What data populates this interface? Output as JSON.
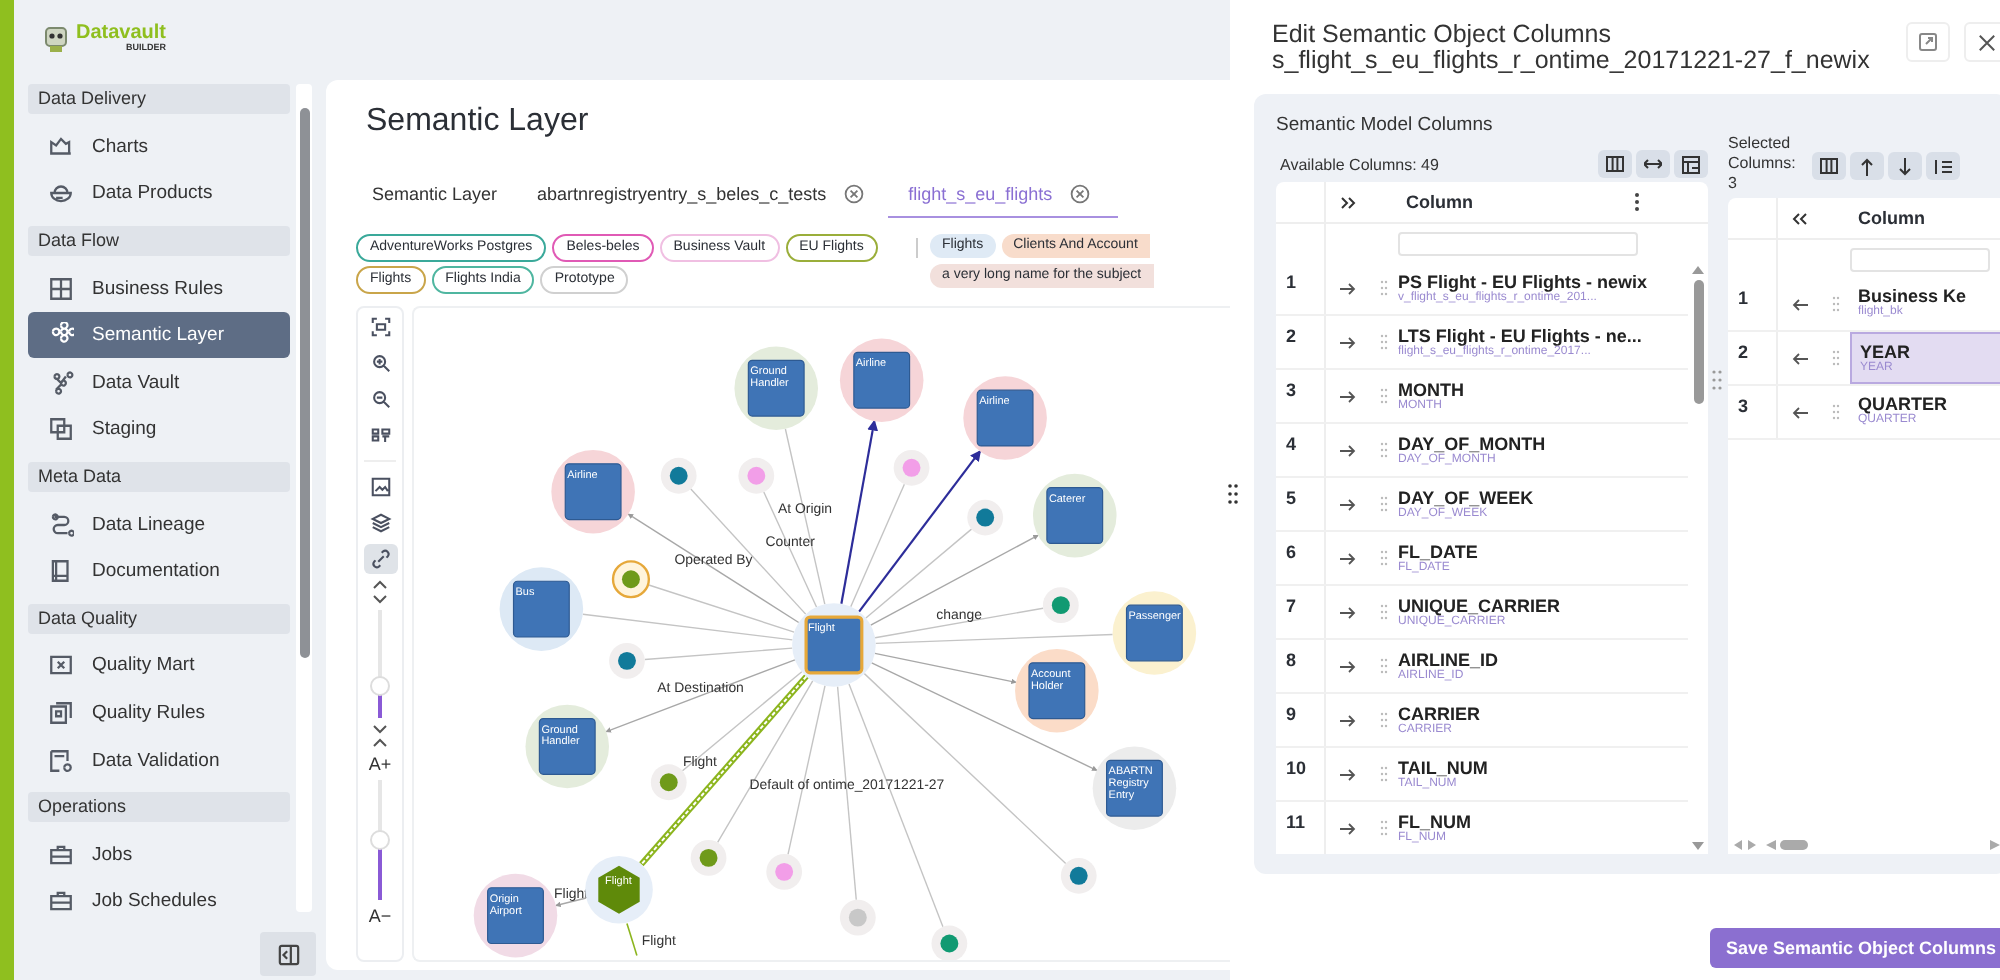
{
  "logo": {
    "name": "Datavault",
    "subtitle": "BUILDER"
  },
  "sidebar": {
    "sections": [
      {
        "title": "Data Delivery",
        "items": [
          {
            "label": "Charts",
            "selected": false
          },
          {
            "label": "Data Products",
            "selected": false
          }
        ]
      },
      {
        "title": "Data Flow",
        "items": [
          {
            "label": "Business Rules",
            "selected": false
          },
          {
            "label": "Semantic Layer",
            "selected": true
          },
          {
            "label": "Data Vault",
            "selected": false
          },
          {
            "label": "Staging",
            "selected": false
          }
        ]
      },
      {
        "title": "Meta Data",
        "items": [
          {
            "label": "Data Lineage",
            "selected": false
          },
          {
            "label": "Documentation",
            "selected": false
          }
        ]
      },
      {
        "title": "Data Quality",
        "items": [
          {
            "label": "Quality Mart",
            "selected": false
          },
          {
            "label": "Quality Rules",
            "selected": false
          },
          {
            "label": "Data Validation",
            "selected": false
          }
        ]
      },
      {
        "title": "Operations",
        "items": [
          {
            "label": "Jobs",
            "selected": false
          },
          {
            "label": "Job Schedules",
            "selected": false
          }
        ]
      }
    ]
  },
  "page": {
    "title": "Semantic Layer",
    "tabs": [
      {
        "label": "Semantic Layer",
        "selected": false,
        "closable": false
      },
      {
        "label": "abartnregistryentry_s_beles_c_tests",
        "selected": false,
        "closable": true
      },
      {
        "label": "flight_s_eu_flights",
        "selected": true,
        "closable": true
      }
    ],
    "source_tags": [
      {
        "label": "AdventureWorks Postgres",
        "color": "#3aa99a"
      },
      {
        "label": "Beles-beles",
        "color": "#e05ab5"
      },
      {
        "label": "Business Vault",
        "color": "#f0bfe2"
      },
      {
        "label": "EU Flights",
        "color": "#9aae3a"
      },
      {
        "label": "Flights",
        "color": "#c9a54a"
      },
      {
        "label": "Flights India",
        "color": "#4fb6a0"
      },
      {
        "label": "Prototype",
        "color": "#d0d0d0"
      }
    ],
    "subject_tags": [
      {
        "label": "Flights",
        "color": "#dfeaf5"
      },
      {
        "label": "Clients And Account",
        "color": "#f8dccb"
      },
      {
        "label": "a very long name for the subject",
        "color": "#f2e0dc"
      }
    ]
  },
  "graph_toolbar": {
    "tools": [
      {
        "selected": false
      },
      {
        "selected": false
      },
      {
        "selected": false
      },
      {
        "selected": false
      },
      {
        "selected": false
      },
      {
        "selected": false
      },
      {
        "selected": true
      }
    ],
    "zoom": {
      "level": 0.3
    },
    "font_size": {
      "increase": "A+",
      "decrease": "A−",
      "level": 0.5
    }
  },
  "graph": {
    "nodes": [
      {
        "kind": "entity",
        "label": "Airline",
        "color": "#f6d5d8",
        "selected": false,
        "edge": {
          "kind": "directed"
        }
      },
      {
        "kind": "entity",
        "label": "Ground Handler",
        "color": "#e4ecdc",
        "selected": false,
        "edge": {
          "kind": "plain",
          "label": "At Origin"
        }
      },
      {
        "kind": "entity",
        "label": "Airline",
        "color": "#f6d5d8",
        "selected": false,
        "edge": {
          "kind": "directed"
        }
      },
      {
        "kind": "dot",
        "color": "#f29ee8",
        "selected": false,
        "edge": {
          "kind": "plain"
        }
      },
      {
        "kind": "dot",
        "color": "#117a9a",
        "selected": false,
        "edge": {
          "kind": "plain"
        }
      },
      {
        "kind": "dot",
        "color": "#f29ee8",
        "selected": false,
        "edge": {
          "kind": "plain",
          "label": "Counter"
        }
      },
      {
        "kind": "entity",
        "label": "Airline",
        "color": "#f6d5d8",
        "selected": false,
        "edge": {
          "kind": "arrow",
          "label": "Operated By"
        }
      },
      {
        "kind": "entity",
        "label": "Caterer",
        "color": "#e4ecdc",
        "selected": false,
        "edge": {
          "kind": "arrow"
        }
      },
      {
        "kind": "dot",
        "color": "#117a9a",
        "selected": false,
        "edge": {
          "kind": "plain"
        }
      },
      {
        "kind": "dot",
        "color": "#6f9a1a",
        "selected": true,
        "edge": {
          "kind": "plain"
        }
      },
      {
        "kind": "dot",
        "color": "#119a72",
        "selected": false,
        "edge": {
          "kind": "plain",
          "label": "change"
        }
      },
      {
        "kind": "entity",
        "label": "Bus",
        "color": "#dde9f5",
        "selected": false,
        "edge": {
          "kind": "plain"
        }
      },
      {
        "kind": "entity",
        "label": "Passenger",
        "color": "#fbf1cf",
        "selected": false,
        "edge": {
          "kind": "plain"
        }
      },
      {
        "kind": "hub",
        "label": "Flight",
        "color": "#e6eef8",
        "selected": true
      },
      {
        "kind": "dot",
        "color": "#117a9a",
        "selected": false,
        "edge": {
          "kind": "plain"
        }
      },
      {
        "kind": "entity",
        "label": "Account Holder",
        "color": "#fbdcc8",
        "selected": false,
        "edge": {
          "kind": "arrow"
        }
      },
      {
        "kind": "entity",
        "label": "Ground Handler",
        "color": "#e4ecdc",
        "selected": false,
        "edge": {
          "kind": "arrow",
          "label": "At Destination"
        }
      },
      {
        "kind": "dot",
        "color": "#6f9a1a",
        "selected": false,
        "edge": {
          "kind": "plain"
        }
      },
      {
        "kind": "entity",
        "label": "ABARTN Registry Entry",
        "color": "#ececec",
        "selected": false,
        "edge": {
          "kind": "arrow"
        }
      },
      {
        "kind": "dot",
        "color": "#6f9a1a",
        "selected": false,
        "edge": {
          "kind": "plain"
        }
      },
      {
        "kind": "dot",
        "color": "#f29ee8",
        "selected": false,
        "edge": {
          "kind": "plain"
        }
      },
      {
        "kind": "dot",
        "color": "#117a9a",
        "selected": false,
        "edge": {
          "kind": "plain"
        }
      },
      {
        "kind": "hex",
        "label": "Flight",
        "color": "#5f8a0a",
        "selected": false,
        "edge": {
          "kind": "highlighted",
          "label": "Flight"
        },
        "children": [
          {
            "kind": "entity",
            "label": "Origin Airport",
            "color": "#f1dbe6",
            "selected": false,
            "edge": {
              "kind": "arrow",
              "label": "Flight"
            }
          }
        ]
      },
      {
        "kind": "dot",
        "color": "#c8c8c8",
        "selected": false,
        "edge": {
          "kind": "plain",
          "label": "Default of ontime_20171221-27"
        }
      },
      {
        "kind": "dot",
        "color": "#119a72",
        "selected": false,
        "edge": {
          "kind": "plain"
        }
      }
    ],
    "stub_label": "Flight"
  },
  "dialog": {
    "title": "Edit Semantic Object Columns",
    "subtitle": "s_flight_s_eu_flights_r_ontime_20171221-27_f_newix",
    "section_title": "Semantic Model Columns",
    "available": {
      "caption": "Available Columns: 49",
      "column_header": "Column",
      "rows": [
        {
          "index": "1",
          "name": "PS Flight - EU Flights - newix",
          "source": "v_flight_s_eu_flights_r_ontime_201..."
        },
        {
          "index": "2",
          "name": "LTS Flight - EU Flights - ne...",
          "source": "flight_s_eu_flights_r_ontime_2017..."
        },
        {
          "index": "3",
          "name": "MONTH",
          "source": "MONTH"
        },
        {
          "index": "4",
          "name": "DAY_OF_MONTH",
          "source": "DAY_OF_MONTH"
        },
        {
          "index": "5",
          "name": "DAY_OF_WEEK",
          "source": "DAY_OF_WEEK"
        },
        {
          "index": "6",
          "name": "FL_DATE",
          "source": "FL_DATE"
        },
        {
          "index": "7",
          "name": "UNIQUE_CARRIER",
          "source": "UNIQUE_CARRIER"
        },
        {
          "index": "8",
          "name": "AIRLINE_ID",
          "source": "AIRLINE_ID"
        },
        {
          "index": "9",
          "name": "CARRIER",
          "source": "CARRIER"
        },
        {
          "index": "10",
          "name": "TAIL_NUM",
          "source": "TAIL_NUM"
        },
        {
          "index": "11",
          "name": "FL_NUM",
          "source": "FL_NUM"
        }
      ]
    },
    "selected": {
      "caption": "Selected Columns: 3",
      "column_header": "Column",
      "rows": [
        {
          "index": "1",
          "name": "Business Ke",
          "source": "flight_bk",
          "selected": false
        },
        {
          "index": "2",
          "name": "YEAR",
          "source": "YEAR",
          "selected": true
        },
        {
          "index": "3",
          "name": "QUARTER",
          "source": "QUARTER",
          "selected": false
        }
      ]
    },
    "save_button": "Save Semantic Object Columns"
  }
}
